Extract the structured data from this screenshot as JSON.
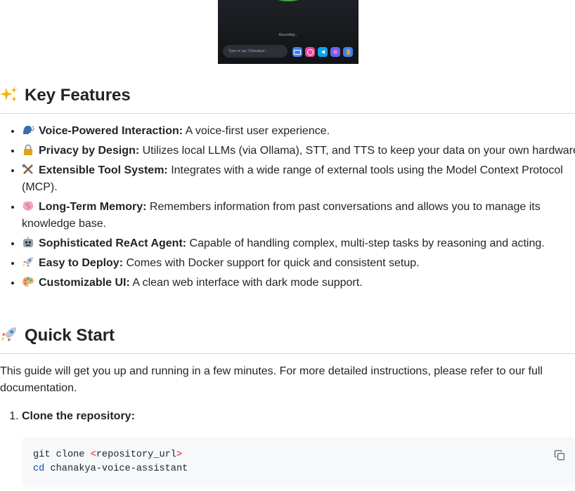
{
  "hero_image": {
    "recording_text": "Recording...",
    "input_placeholder": "Type or say 'Chanakya'...",
    "buttons": [
      {
        "icon": "keyboard-icon",
        "color": "#3b82f6"
      },
      {
        "icon": "record-icon",
        "color": "#ec4899"
      },
      {
        "icon": "volume-icon",
        "color": "#0ea5e9"
      },
      {
        "icon": "settings-icon",
        "color": "#6366f1"
      },
      {
        "icon": "hand-icon",
        "color": "#f59e0b"
      }
    ]
  },
  "features_section": {
    "heading": "Key Features",
    "emoji": "sparkles",
    "items": [
      {
        "emoji": "speaking-head",
        "title": "Voice-Powered Interaction:",
        "text": " A voice-first user experience."
      },
      {
        "emoji": "lock",
        "title": "Privacy by Design:",
        "text": " Utilizes local LLMs (via Ollama), STT, and TTS to keep your data on your own hardware."
      },
      {
        "emoji": "tools",
        "title": "Extensible Tool System:",
        "text": " Integrates with a wide range of external tools using the Model Context Protocol (MCP)."
      },
      {
        "emoji": "brain",
        "title": "Long-Term Memory:",
        "text": " Remembers information from past conversations and allows you to manage its knowledge base."
      },
      {
        "emoji": "robot",
        "title": "Sophisticated ReAct Agent:",
        "text": " Capable of handling complex, multi-step tasks by reasoning and acting."
      },
      {
        "emoji": "rocket",
        "title": "Easy to Deploy:",
        "text": " Comes with Docker support for quick and consistent setup."
      },
      {
        "emoji": "palette",
        "title": "Customizable UI:",
        "text": " A clean web interface with dark mode support."
      }
    ]
  },
  "quickstart_section": {
    "heading": "Quick Start",
    "emoji": "rocket",
    "intro": "This guide will get you up and running in a few minutes. For more detailed instructions, please refer to our full documentation.",
    "steps": [
      {
        "title": "Clone the repository:",
        "code": {
          "line1_cmd": "git clone ",
          "line1_lt": "<",
          "line1_arg": "repository_url",
          "line1_gt": ">",
          "line2_cmd": "cd",
          "line2_arg": " chanakya-voice-assistant"
        }
      }
    ]
  },
  "copy_button": {
    "icon": "copy-icon"
  }
}
